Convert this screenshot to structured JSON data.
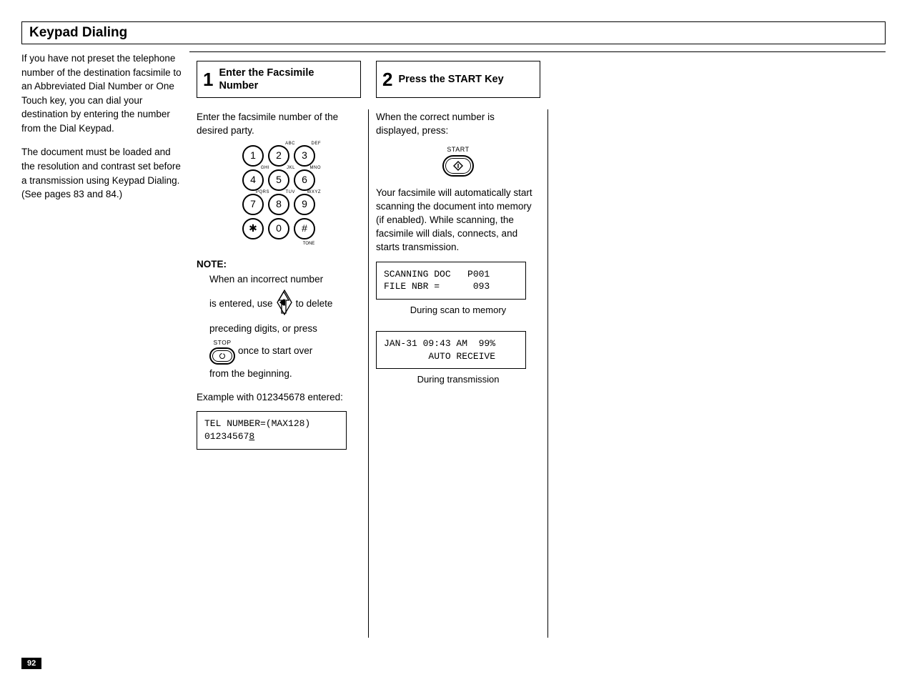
{
  "section_title": "Keypad  Dialing",
  "intro": {
    "p1": "If you have not preset the telephone number of the destination facsimile to an Abbreviated Dial Number or One Touch key, you can dial your destination by entering the number from the Dial Keypad.",
    "p2": "The document must be loaded and the resolution and contrast set before a transmission using Keypad Dialing. (See pages 83 and 84.)"
  },
  "step1": {
    "number": "1",
    "title": "Enter the Facsimile Number",
    "intro": "Enter the facsimile number of the desired party.",
    "keypad": {
      "rows": [
        [
          {
            "d": "1",
            "sup": ""
          },
          {
            "d": "2",
            "sup": "ABC"
          },
          {
            "d": "3",
            "sup": "DEF"
          }
        ],
        [
          {
            "d": "4",
            "sup": "GHI"
          },
          {
            "d": "5",
            "sup": "JKL"
          },
          {
            "d": "6",
            "sup": "MNO"
          }
        ],
        [
          {
            "d": "7",
            "sup": "PQRS"
          },
          {
            "d": "8",
            "sup": "TUV"
          },
          {
            "d": "9",
            "sup": "WXYZ"
          }
        ],
        [
          {
            "d": "✱",
            "sup": ""
          },
          {
            "d": "0",
            "sup": ""
          },
          {
            "d": "#",
            "sup": ""
          }
        ]
      ],
      "tone": "TONE"
    },
    "note_head": "NOTE:",
    "note_l1": "When an incorrect number",
    "note_l2a": "is entered, use",
    "note_l2b": "to delete",
    "note_l3": "preceding digits, or press",
    "note_stop_label": "STOP",
    "note_l4b": "once to start over",
    "note_l5": "from the beginning.",
    "example_intro": "Example with 012345678 entered:",
    "lcd_line1": "TEL NUMBER=(MAX128)",
    "lcd_line2a": "01234567",
    "lcd_line2b": "8"
  },
  "step2": {
    "number": "2",
    "title": "Press the START Key",
    "intro": "When the correct number is displayed,  press:",
    "start_label": "START",
    "body": "Your facsimile will automatically start scanning the document into memory (if enabled). While scanning, the facsimile will dials, connects, and starts transmission.",
    "lcd1_line1": "SCANNING DOC   P001",
    "lcd1_line2": "FILE NBR =      093",
    "cap1": "During scan to memory",
    "lcd2_line1": "JAN-31 09:43 AM  99%",
    "lcd2_line2": "        AUTO RECEIVE",
    "cap2": "During  transmission"
  },
  "page_number": "92"
}
